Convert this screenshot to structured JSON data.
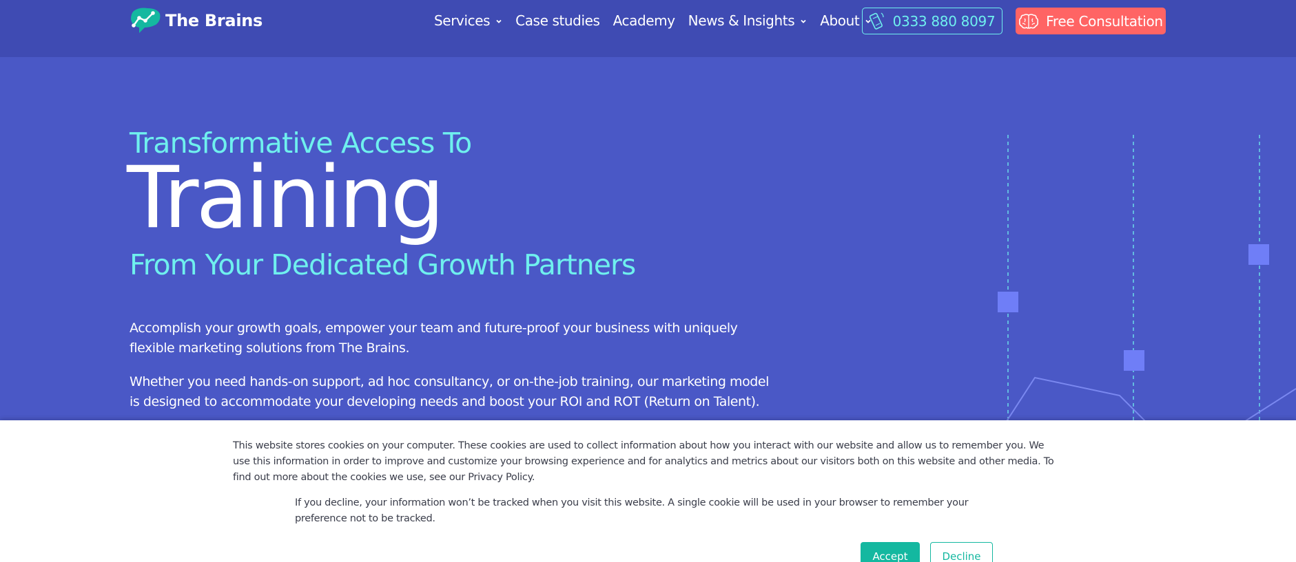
{
  "header": {
    "logo_text": "The Brains",
    "nav": [
      {
        "label": "Services",
        "has_dropdown": true
      },
      {
        "label": "Case studies",
        "has_dropdown": false
      },
      {
        "label": "Academy",
        "has_dropdown": false
      },
      {
        "label": "News & Insights",
        "has_dropdown": true
      },
      {
        "label": "About",
        "has_dropdown": true
      }
    ],
    "phone": "0333 880 8097",
    "cta_label": "Free Consultation"
  },
  "hero": {
    "kicker": "Transformative Access To",
    "title": "Training",
    "subtitle": "From Your Dedicated Growth Partners",
    "paragraph1": "Accomplish your growth goals, empower your team and future-proof your business with uniquely flexible marketing solutions from The Brains.",
    "paragraph2": "Whether you need hands-on support, ad hoc consultancy, or on-the-job training, our marketing model is designed to accommodate your developing needs and boost your ROI and ROT (Return on Talent)."
  },
  "cookie_banner": {
    "text": "This website stores cookies on your computer. These cookies are used to collect information about how you interact with our website and allow us to remember you. We use this information in order to improve and customize your browsing experience and for analytics and metrics about our visitors both on this website and other media. To find out more about the cookies we use, see our ",
    "policy_link": "Privacy Policy",
    "text_end": ".",
    "decline_note": "If you decline, your information won’t be tracked when you visit this website. A single cookie will be used in your browser to remember your preference not to be tracked.",
    "accept_label": "Accept",
    "decline_label": "Decline"
  },
  "colors": {
    "header_bg": "#3f4bb3",
    "hero_bg": "#4a58c6",
    "accent_cyan": "#6ff0ee",
    "cta_red": "#ff6464",
    "cookie_teal": "#14b8a0"
  },
  "icons": {
    "logo": "brain-chart-logo-icon",
    "phone": "phone-icon",
    "consult": "brain-icon",
    "dropdown": "chevron-down-icon"
  }
}
